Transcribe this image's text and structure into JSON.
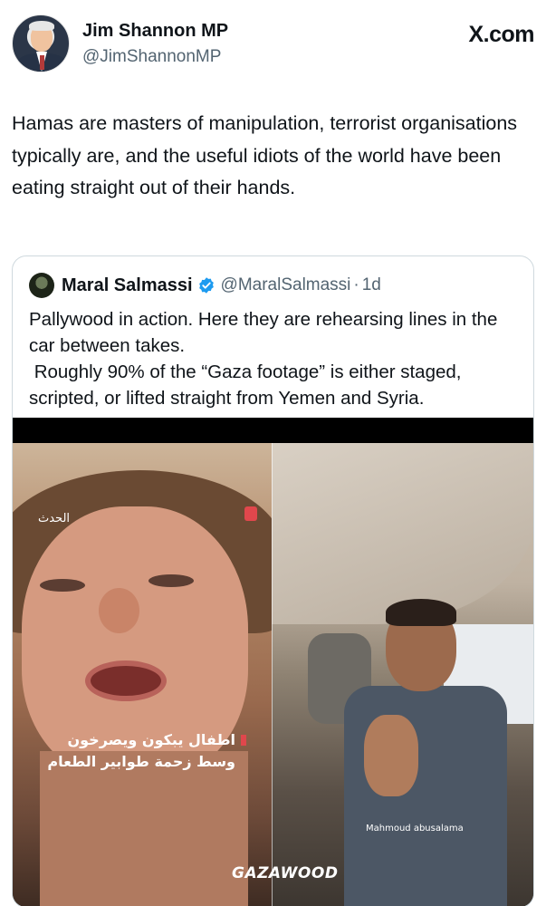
{
  "author": {
    "name": "Jim Shannon MP",
    "handle": "@JimShannonMP"
  },
  "site_logo": "X.com",
  "tweet": {
    "text": "Hamas are masters of manipulation, terrorist organisations typically are, and the useful idiots of the world have been eating straight out of their hands."
  },
  "quoted_tweet": {
    "name": "Maral Salmassi",
    "handle": "@MaralSalmassi",
    "separator": "·",
    "time": "1d",
    "text": "Pallywood in action. Here they are rehearsing lines in the car between takes.\n Roughly 90% of the “Gaza footage” is either staged, scripted, or lifted straight from Yemen and Syria.",
    "media": {
      "left_tag": "الحدث",
      "left_caption_line1": "اطفال يبكون ويصرخون",
      "left_caption_line2": "وسط زحمة طوابير الطعام",
      "right_caption": "Mahmoud abusalama",
      "watermark": "GAZAWOOD"
    }
  },
  "colors": {
    "text": "#0f1419",
    "secondary": "#536471",
    "verified": "#1d9bf0",
    "border": "#cfd9de"
  }
}
